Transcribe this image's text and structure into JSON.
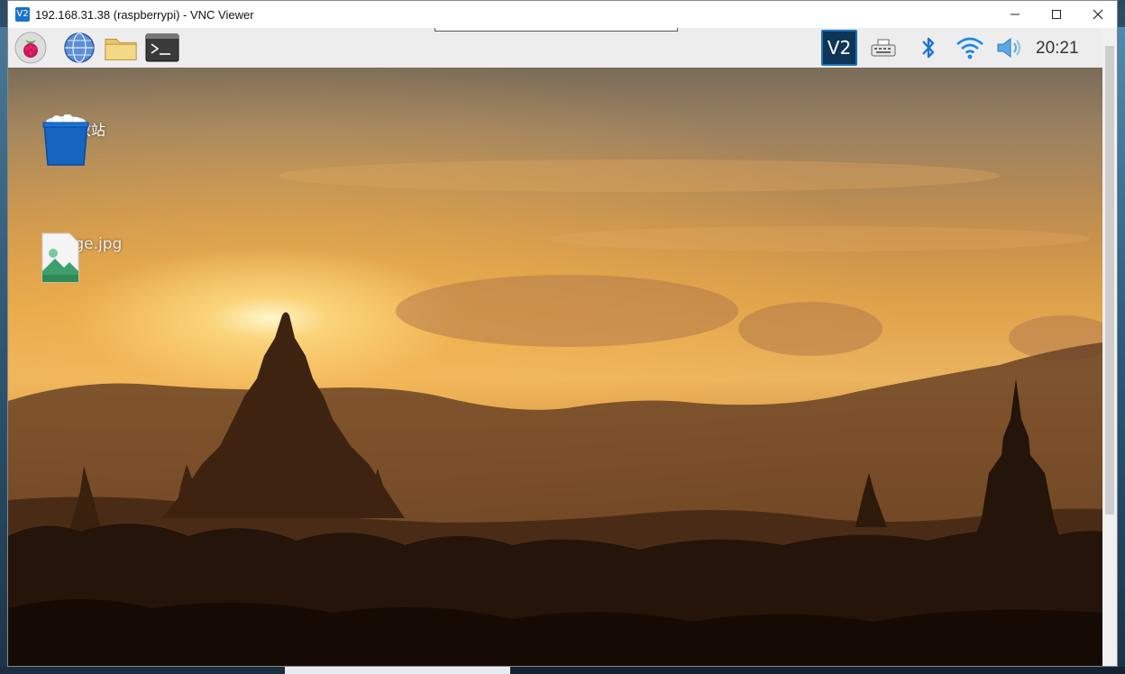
{
  "window": {
    "title": "192.168.31.38 (raspberrypi) - VNC Viewer",
    "app_icon_text": "V2",
    "controls": {
      "minimize": "minimize-icon",
      "maximize": "maximize-icon",
      "close": "close-icon"
    }
  },
  "taskbar": {
    "launchers": [
      {
        "name": "raspberry-menu-icon"
      },
      {
        "name": "web-browser-icon"
      },
      {
        "name": "file-manager-icon"
      },
      {
        "name": "terminal-icon"
      }
    ],
    "tray": {
      "vnc_label": "V2",
      "keyboard_icon": "keyboard-icon",
      "bluetooth_icon": "bluetooth-icon",
      "wifi_icon": "wifi-icon",
      "volume_icon": "volume-icon",
      "clock": "20:21"
    }
  },
  "desktop": {
    "icons": [
      {
        "label": "回收站",
        "icon": "trash-icon"
      },
      {
        "label": "image.jpg",
        "icon": "image-file-icon"
      }
    ]
  },
  "colors": {
    "taskbar_bg": "#ededed",
    "vnc_tray_bg": "#0f3556",
    "trash_blue": "#1565c0"
  }
}
